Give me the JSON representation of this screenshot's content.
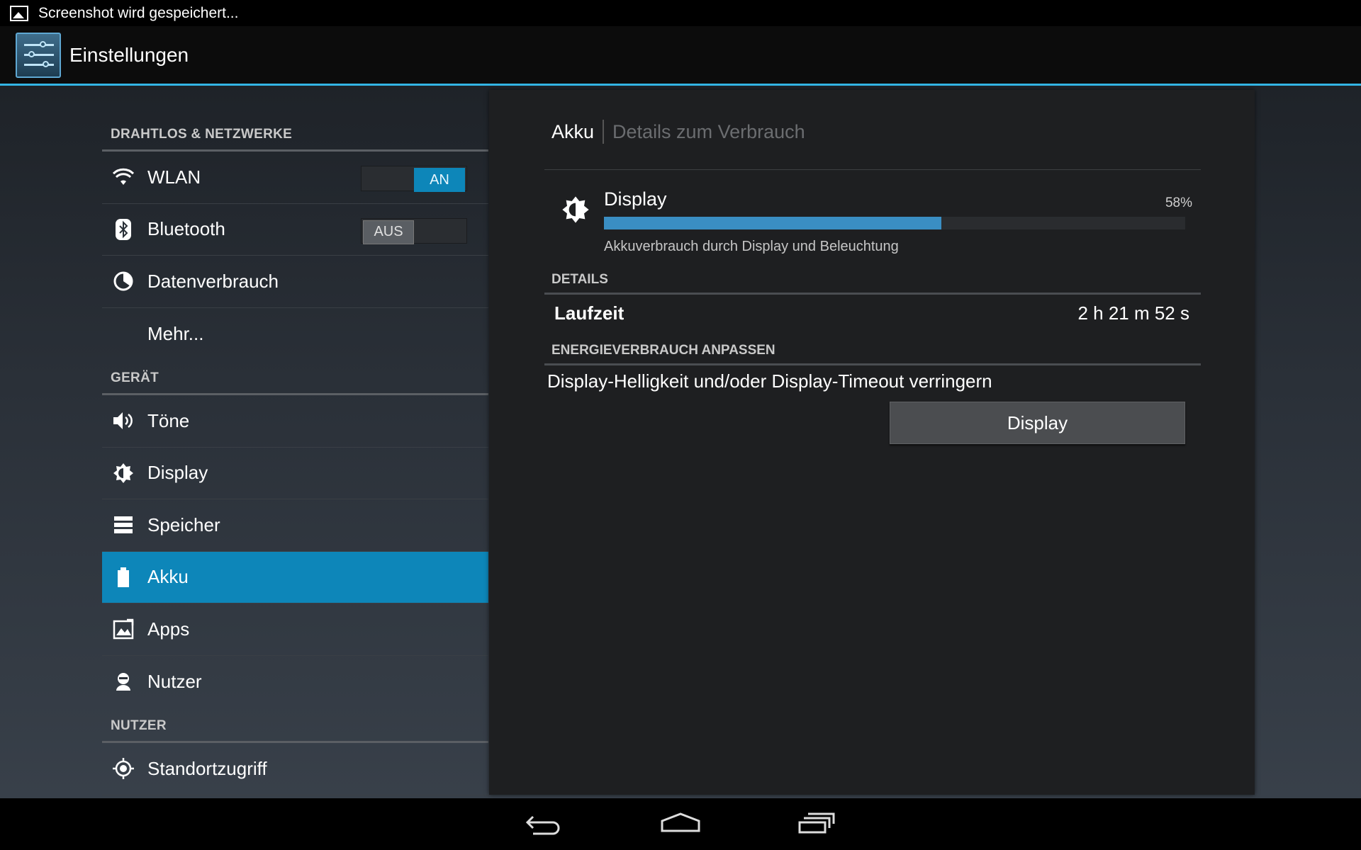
{
  "statusbar": {
    "notification": "Screenshot wird gespeichert..."
  },
  "actionbar": {
    "title": "Einstellungen"
  },
  "sidebar": {
    "sections": [
      {
        "header": "DRAHTLOS & NETZWERKE"
      },
      {
        "header": "GERÄT"
      },
      {
        "header": "NUTZER"
      }
    ],
    "items": [
      {
        "label": "WLAN",
        "icon": "wifi-icon",
        "toggle": "AN"
      },
      {
        "label": "Bluetooth",
        "icon": "bluetooth-icon",
        "toggle": "AUS"
      },
      {
        "label": "Datenverbrauch",
        "icon": "data-usage-icon"
      },
      {
        "label": "Mehr..."
      },
      {
        "label": "Töne",
        "icon": "speaker-icon"
      },
      {
        "label": "Display",
        "icon": "brightness-icon"
      },
      {
        "label": "Speicher",
        "icon": "storage-icon"
      },
      {
        "label": "Akku",
        "icon": "battery-icon",
        "selected": true
      },
      {
        "label": "Apps",
        "icon": "apps-icon"
      },
      {
        "label": "Nutzer",
        "icon": "user-icon"
      },
      {
        "label": "Standortzugriff",
        "icon": "location-icon"
      }
    ]
  },
  "detail": {
    "breadcrumb": {
      "current": "Akku",
      "sub": "Details zum Verbrauch"
    },
    "usage": {
      "name": "Display",
      "percent_label": "58%",
      "percent": 58,
      "description": "Akkuverbrauch durch Display und Beleuchtung",
      "icon": "brightness-icon",
      "bar_color": "#3a8ec3"
    },
    "details_header": "DETAILS",
    "runtime_label": "Laufzeit",
    "runtime_value": "2 h 21 m 52 s",
    "adjust_header": "ENERGIEVERBRAUCH ANPASSEN",
    "hint": "Display-Helligkeit und/oder Display-Timeout verringern",
    "button_label": "Display"
  },
  "colors": {
    "accent": "#33b5e5",
    "selected": "#0d86b9"
  }
}
